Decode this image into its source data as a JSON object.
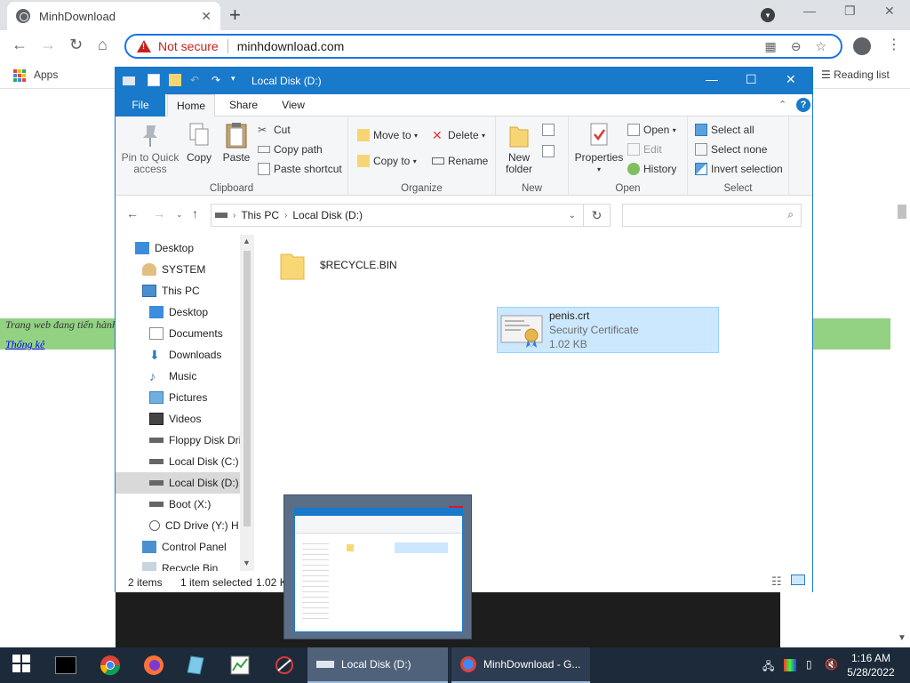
{
  "browser": {
    "tab_title": "MinhDownload",
    "new_tab": "+",
    "not_secure": "Not secure",
    "url": "minhdownload.com",
    "apps": "Apps",
    "reading_list": "Reading list"
  },
  "page": {
    "banner_text": "Trang web đang tiến hành",
    "link_text": "Thống kê"
  },
  "explorer": {
    "title": "Local Disk (D:)",
    "tabs": [
      "File",
      "Home",
      "Share",
      "View"
    ],
    "ribbon": {
      "clipboard": {
        "label": "Clipboard",
        "pin": "Pin to Quick access",
        "copy": "Copy",
        "paste": "Paste",
        "cut": "Cut",
        "copy_path": "Copy path",
        "paste_shortcut": "Paste shortcut"
      },
      "organize": {
        "label": "Organize",
        "move_to": "Move to",
        "copy_to": "Copy to",
        "delete": "Delete",
        "rename": "Rename"
      },
      "new": {
        "label": "New",
        "new_folder": "New folder"
      },
      "open": {
        "label": "Open",
        "properties": "Properties",
        "open": "Open",
        "edit": "Edit",
        "history": "History"
      },
      "select": {
        "label": "Select",
        "select_all": "Select all",
        "select_none": "Select none",
        "invert": "Invert selection"
      }
    },
    "address": {
      "this_pc": "This PC",
      "current": "Local Disk (D:)"
    },
    "nav_items": [
      {
        "label": "Desktop"
      },
      {
        "label": "SYSTEM"
      },
      {
        "label": "This PC"
      },
      {
        "label": "Desktop"
      },
      {
        "label": "Documents"
      },
      {
        "label": "Downloads"
      },
      {
        "label": "Music"
      },
      {
        "label": "Pictures"
      },
      {
        "label": "Videos"
      },
      {
        "label": "Floppy Disk Dri"
      },
      {
        "label": "Local Disk (C:)"
      },
      {
        "label": "Local Disk (D:)"
      },
      {
        "label": "Boot (X:)"
      },
      {
        "label": "CD Drive (Y:) H"
      },
      {
        "label": "Control Panel"
      },
      {
        "label": "Recycle Bin"
      }
    ],
    "files": [
      {
        "name": "$RECYCLE.BIN"
      },
      {
        "name": "penis.crt",
        "type": "Security Certificate",
        "size": "1.02 KB"
      }
    ],
    "status": {
      "items": "2 items",
      "selected": "1 item selected",
      "size": "1.02 KB"
    }
  },
  "taskbar": {
    "explorer_label": "Local Disk (D:)",
    "chrome_label": "MinhDownload - G...",
    "time": "1:16 AM",
    "date": "5/28/2022"
  },
  "colors": {
    "accent": "#1979ca",
    "banner": "#92d282",
    "selection": "#cce8ff",
    "taskbar": "#1c2a3a"
  }
}
